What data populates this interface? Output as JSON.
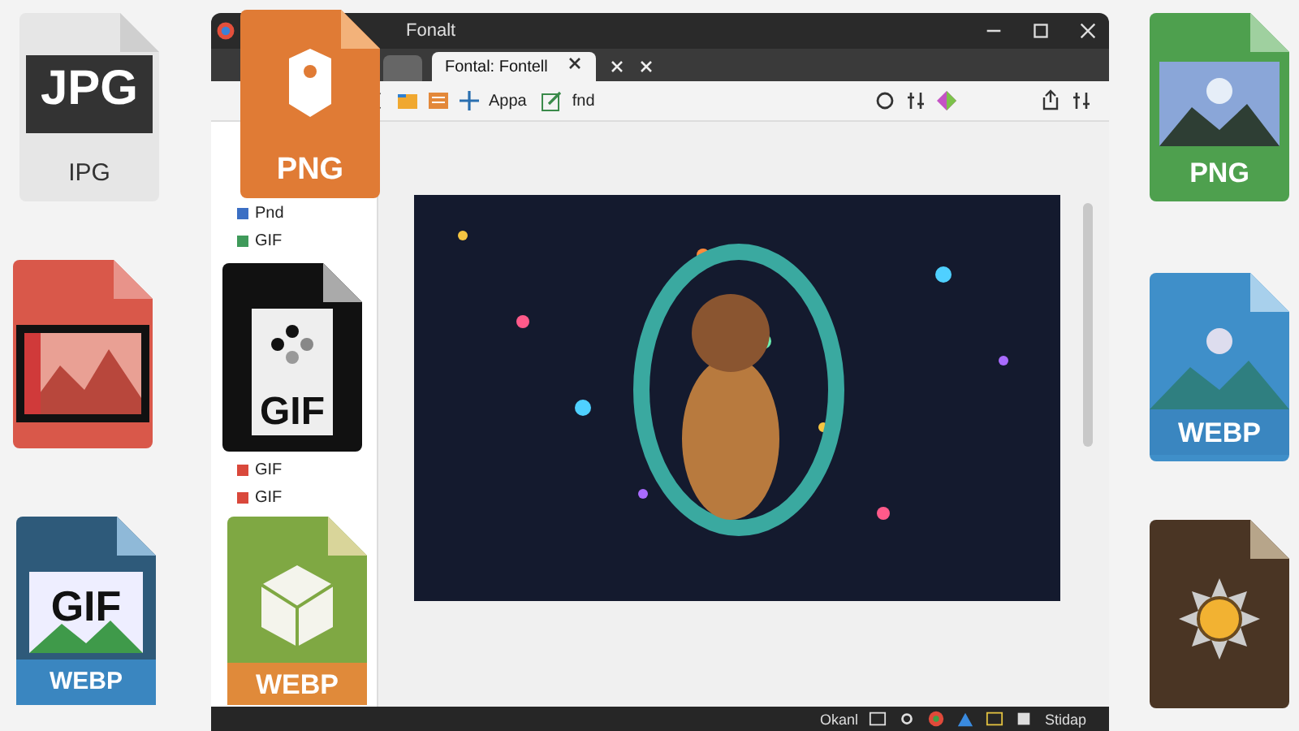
{
  "window": {
    "title": "Fonalt"
  },
  "tabs": [
    {
      "label": "Fontal: Fontell",
      "selected": true
    }
  ],
  "toolbar": {
    "links": [
      "Appa",
      "fnd"
    ]
  },
  "sidebar": {
    "items": [
      {
        "label": "Pnd",
        "color": "#3b6fc4"
      },
      {
        "label": "GIF",
        "color": "#3f9a5a"
      },
      {
        "label": "GIF",
        "color": "#d9483b"
      },
      {
        "label": "GIF",
        "color": "#d9483b"
      }
    ]
  },
  "status_bar": {
    "left": "Okanl",
    "right": "Stidap"
  },
  "file_icons": [
    {
      "kind": "jpg",
      "label": "JPG",
      "caption": "IPG"
    },
    {
      "kind": "photo-red"
    },
    {
      "kind": "gif-webp",
      "label": "GIF",
      "caption": "WEBP"
    },
    {
      "kind": "png-orange",
      "label": "PNG"
    },
    {
      "kind": "gif-black",
      "label": "GIF"
    },
    {
      "kind": "webp-green",
      "label": "WEBP"
    },
    {
      "kind": "png-green",
      "label": "PNG"
    },
    {
      "kind": "webp-blue",
      "label": "WEBP"
    },
    {
      "kind": "sun"
    }
  ]
}
